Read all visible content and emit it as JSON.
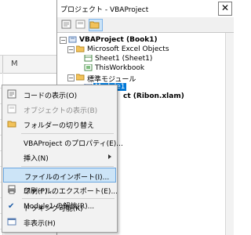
{
  "excel": {
    "column_label": "M"
  },
  "project_window": {
    "title": "プロジェクト - VBAProject",
    "close_label": "✕"
  },
  "tree": {
    "root": "VBAProject (Book1)",
    "excel_objects": "Microsoft Excel Objects",
    "sheet1": "Sheet1 (Sheet1)",
    "thisworkbook": "ThisWorkbook",
    "modules": "標準モジュール",
    "module1": "Module1",
    "project2": "ct (Ribon.xlam)"
  },
  "menu": {
    "items": [
      {
        "label": "コードの表示(O)",
        "icon": "code-icon"
      },
      {
        "label": "オブジェクトの表示(B)",
        "icon": "object-icon",
        "disabled": true
      },
      {
        "label": "フォルダーの切り替え",
        "icon": "folder-icon"
      },
      {
        "label": "VBAProject のプロパティ(E)..."
      },
      {
        "label": "挿入(N)",
        "submenu": true
      },
      {
        "label": "ファイルのインポート(I)...",
        "highlighted": true
      },
      {
        "label": "ファイルのエクスポート(E)..."
      },
      {
        "label": "Module1 の解放(R)..."
      },
      {
        "label": "印刷(P)...",
        "icon": "print-icon"
      },
      {
        "label": "ドッキング可能(K)",
        "checked": true
      },
      {
        "label": "非表示(H)",
        "icon": "hide-icon"
      }
    ]
  },
  "colors": {
    "selection": "#0078d7",
    "menu_highlight": "#cce4f7",
    "menu_bg": "#f2f2f2"
  }
}
